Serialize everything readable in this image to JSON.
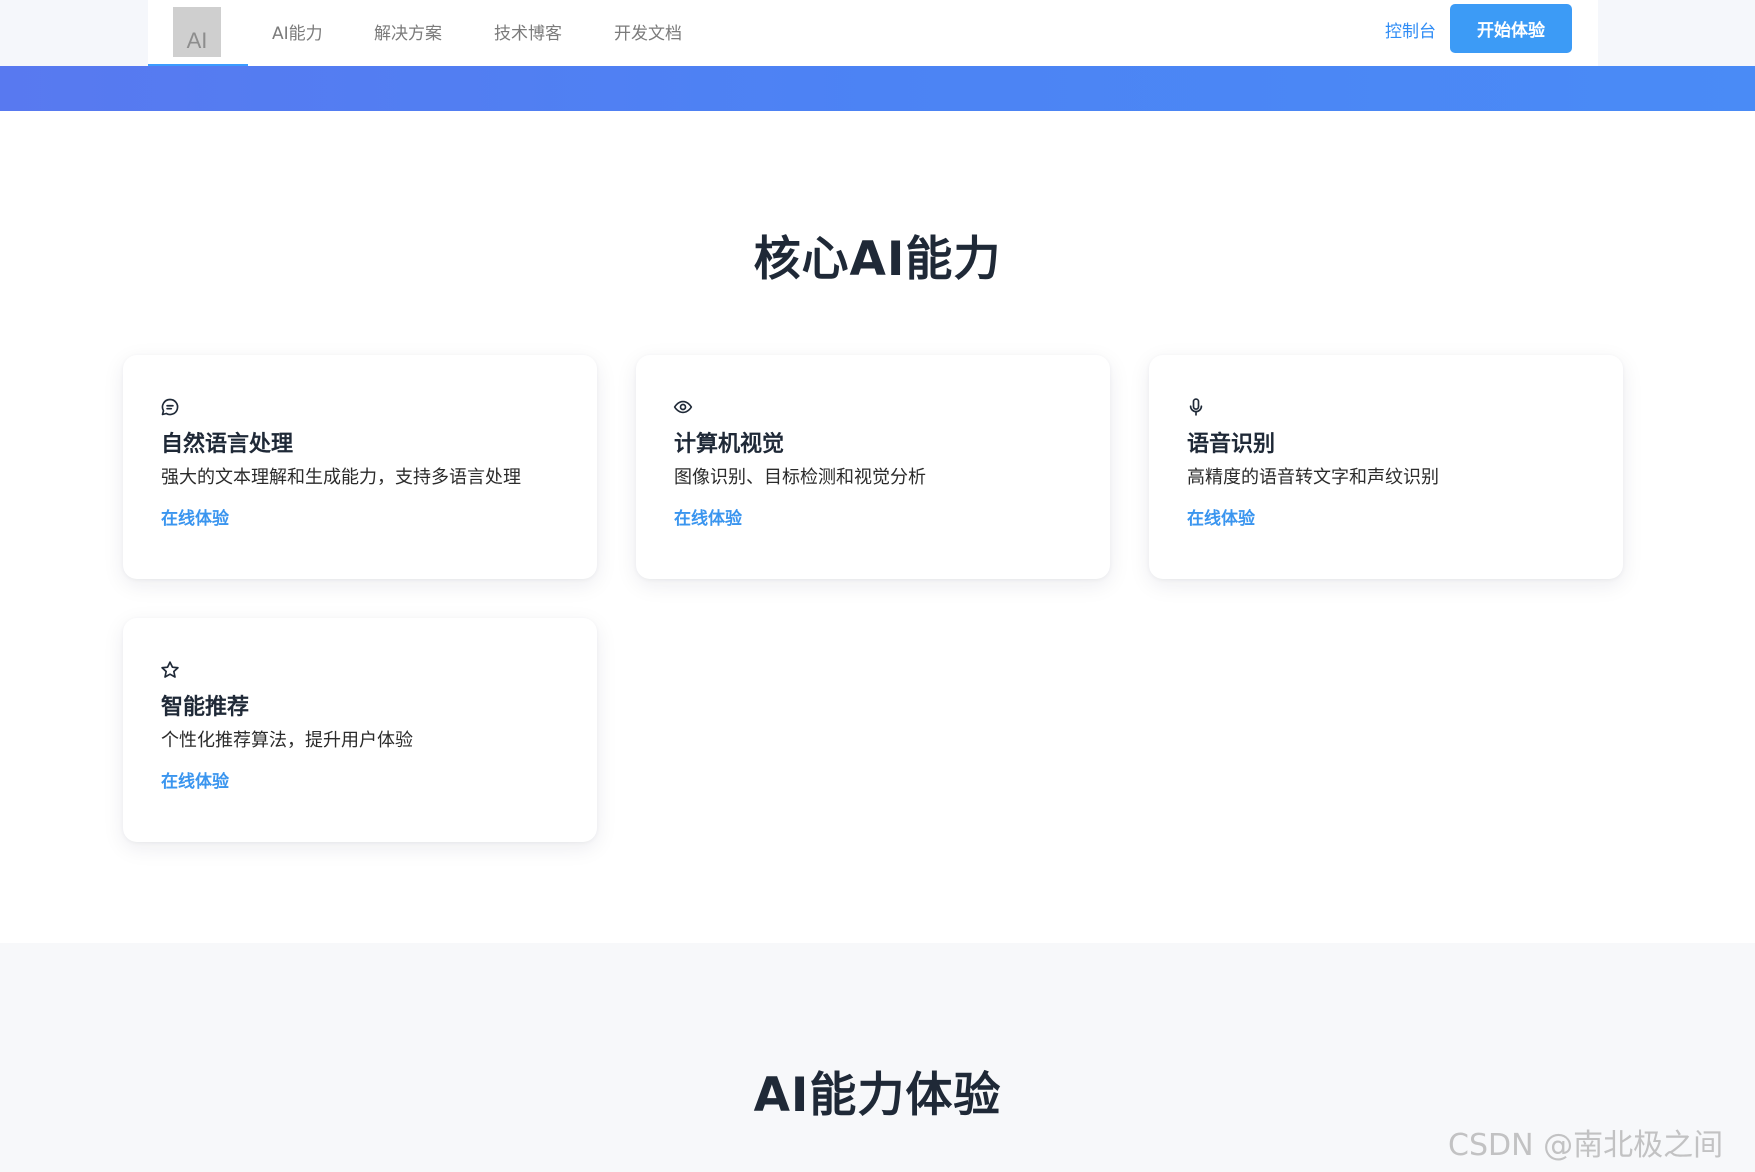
{
  "header": {
    "logo_text": "AI",
    "nav": [
      "AI能力",
      "解决方案",
      "技术博客",
      "开发文档"
    ],
    "console_label": "控制台",
    "start_label": "开始体验"
  },
  "colors": {
    "accent": "#3c9bf6",
    "link": "#3a95ef",
    "band_start": "#5879f0",
    "band_end": "#4a8bf6"
  },
  "capabilities": {
    "title": "核心AI能力",
    "cards": [
      {
        "icon": "chat-bubble-icon",
        "title": "自然语言处理",
        "desc": "强大的文本理解和生成能力，支持多语言处理",
        "link": "在线体验"
      },
      {
        "icon": "eye-icon",
        "title": "计算机视觉",
        "desc": "图像识别、目标检测和视觉分析",
        "link": "在线体验"
      },
      {
        "icon": "microphone-icon",
        "title": "语音识别",
        "desc": "高精度的语音转文字和声纹识别",
        "link": "在线体验"
      },
      {
        "icon": "star-icon",
        "title": "智能推荐",
        "desc": "个性化推荐算法，提升用户体验",
        "link": "在线体验"
      }
    ]
  },
  "experience": {
    "title": "AI能力体验"
  },
  "watermark": "CSDN @南北极之间"
}
